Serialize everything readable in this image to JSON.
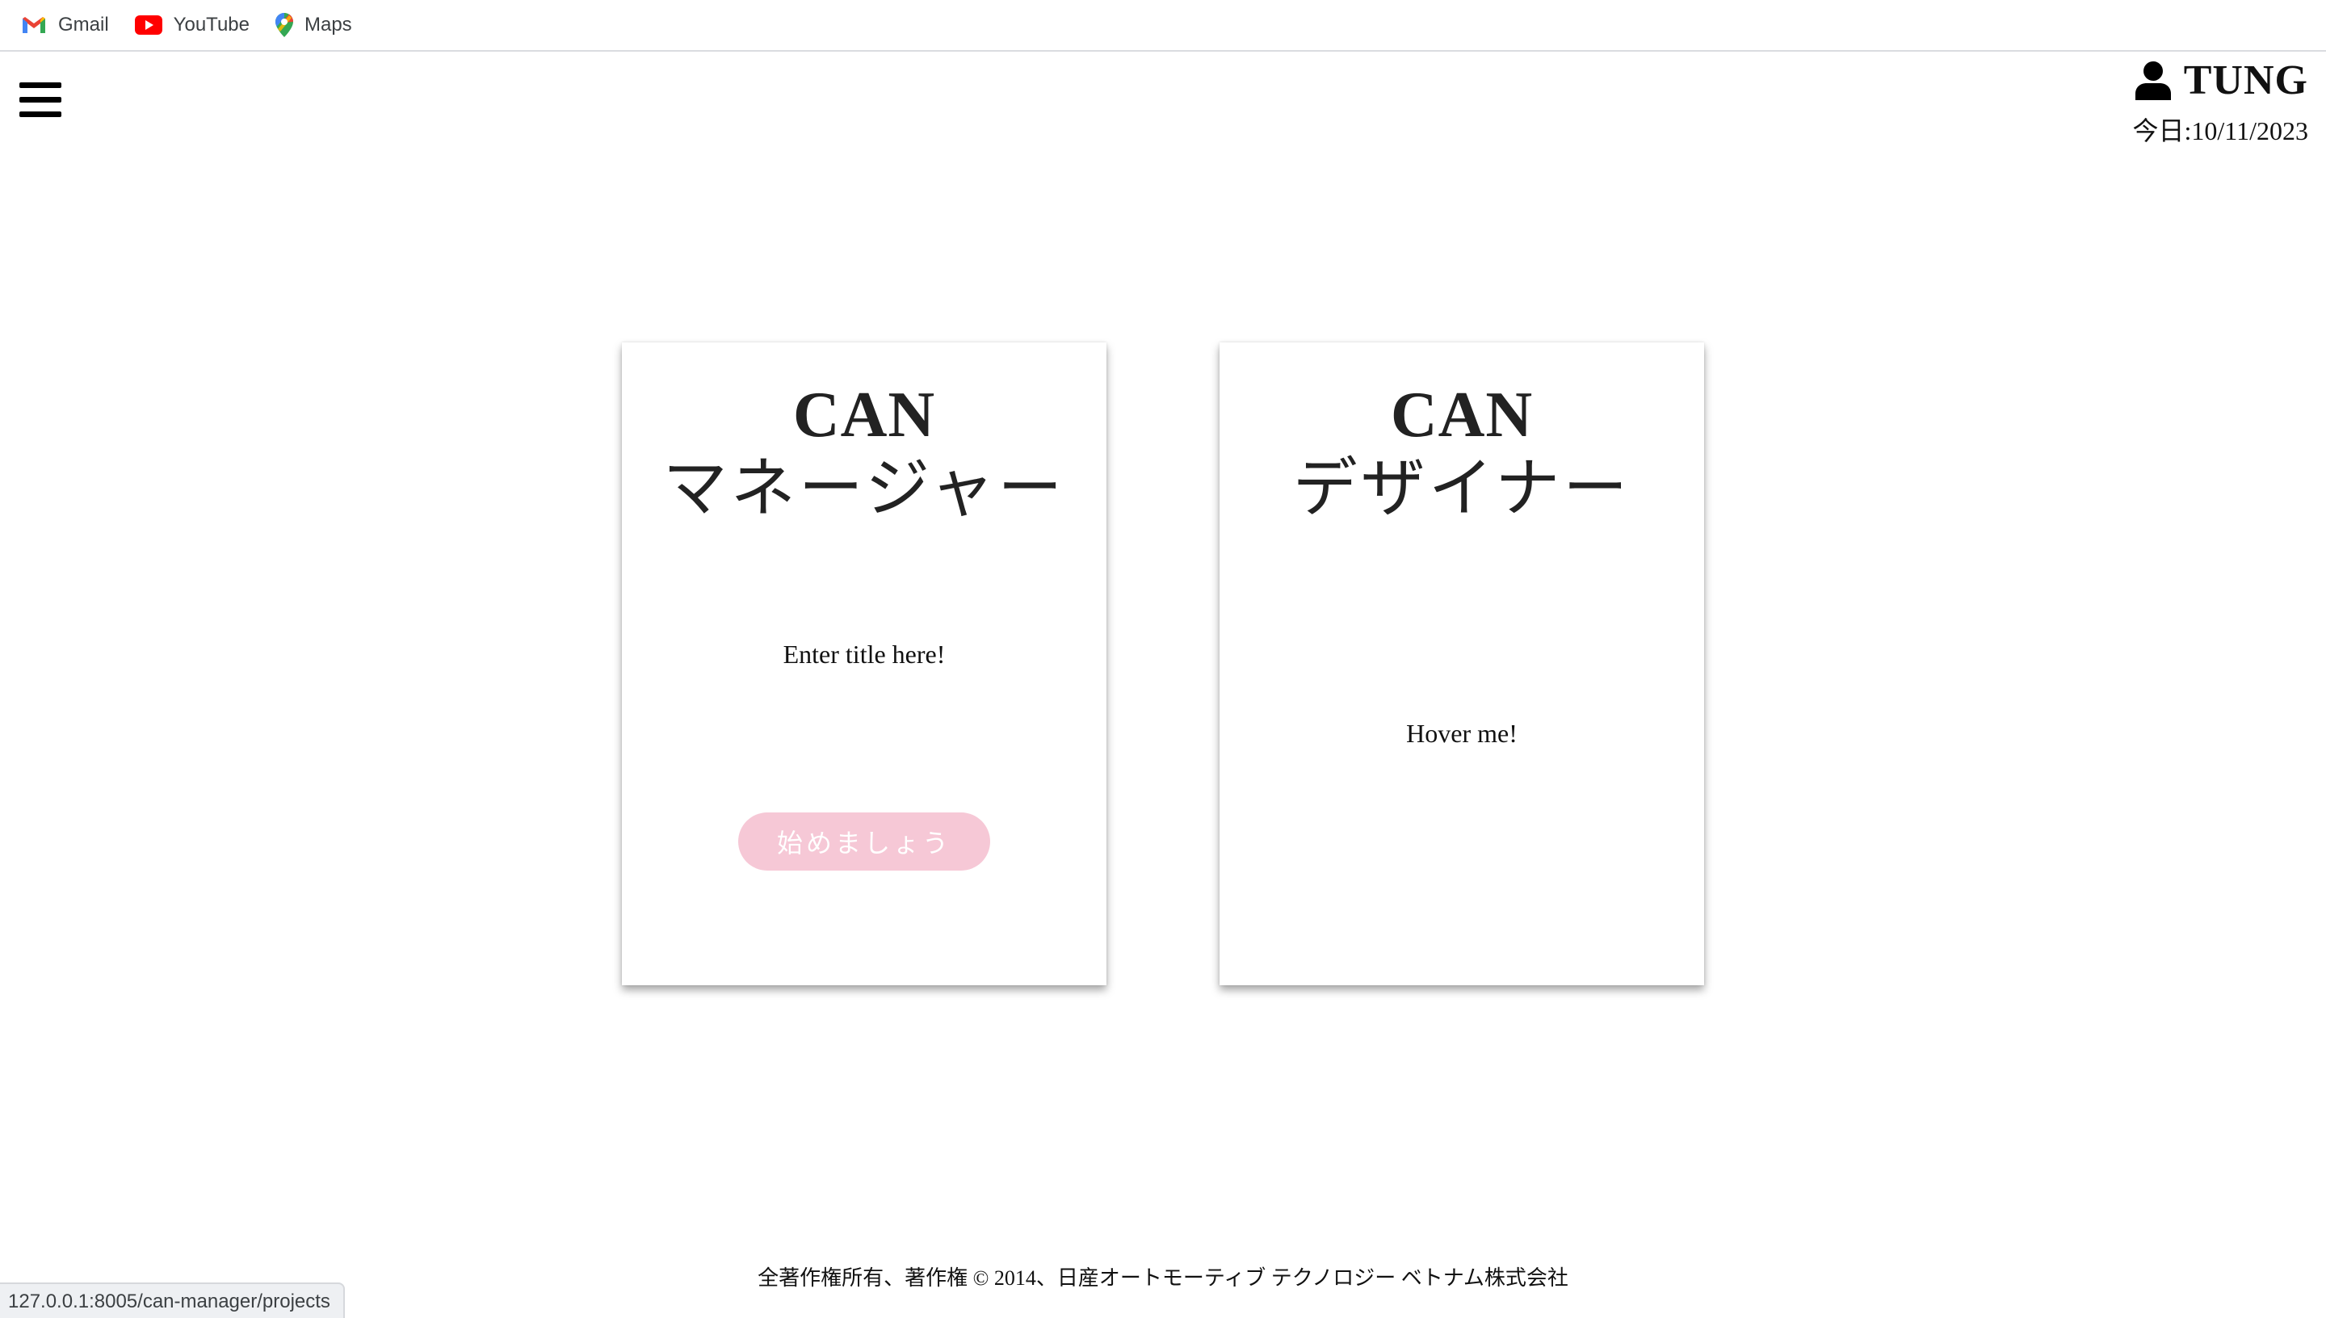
{
  "bookmarks": [
    {
      "label": "Gmail",
      "icon": "gmail-icon"
    },
    {
      "label": "YouTube",
      "icon": "youtube-icon"
    },
    {
      "label": "Maps",
      "icon": "maps-icon"
    }
  ],
  "header": {
    "menu_icon": "hamburger-menu-icon",
    "user_icon": "user-icon",
    "user_name": "TUNG",
    "today": "今日:10/11/2023"
  },
  "cards": [
    {
      "title_en": "CAN",
      "title_jp": "マネージャー",
      "subtitle": "Enter title here!",
      "button_label": "始めましょう"
    },
    {
      "title_en": "CAN",
      "title_jp": "デザイナー",
      "subtitle": "Hover me!"
    }
  ],
  "footer": {
    "copyright": "全著作権所有、著作権 © 2014、日産オートモーティブ テクノロジー ベトナム株式会社"
  },
  "status_bar": {
    "url": "127.0.0.1:8005/can-manager/projects"
  },
  "colors": {
    "button_bg": "#f6c8d6",
    "button_text": "#ffffff"
  }
}
